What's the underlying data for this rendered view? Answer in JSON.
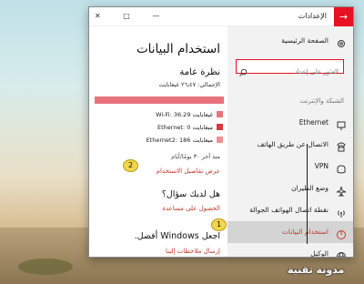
{
  "window": {
    "title": "الإعدادات",
    "back_icon": "back-arrow-icon"
  },
  "sidebar": {
    "home_label": "الصفحة الرئيسية",
    "search_placeholder": "العثور على إعداد",
    "section_header": "الشبكة والإنترنت",
    "items": [
      {
        "label": "Ethernet",
        "icon": "ethernet-icon"
      },
      {
        "label": "الاتصال عن طريق الهاتف",
        "icon": "dialup-icon"
      },
      {
        "label": "VPN",
        "icon": "vpn-icon"
      },
      {
        "label": "وضع الطيران",
        "icon": "airplane-icon"
      },
      {
        "label": "نقطة اتصال الهواتف الجوالة",
        "icon": "hotspot-icon"
      },
      {
        "label": "استخدام البيانات",
        "icon": "data-usage-icon",
        "active": true
      },
      {
        "label": "الوكيل",
        "icon": "globe-icon"
      }
    ]
  },
  "main": {
    "title": "استخدام البيانات",
    "overview_heading": "نظرة عامة",
    "total": "الإجمالي: ٢٦٫٤٧ غيغابايت",
    "usage_fill_fraction": 1.0,
    "networks": [
      {
        "label": "Wi-Fi: 36.29 غيغابايت",
        "color": "#e8737d"
      },
      {
        "label": "Ethernet: 0 ميغابايت",
        "color": "#d9363e"
      },
      {
        "label": "Ethernet2: 186 ميغابايت",
        "color": "#ee8f95"
      }
    ],
    "period": "منذ آخر ٣٠ يومًا/أيام",
    "details_link": "عرض تفاصيل الاستخدام",
    "question_heading": "هل لديك سؤال؟",
    "help_link": "الحصول على مساعدة",
    "improve_heading": "اجعل Windows أفضل.",
    "feedback_link": "إرسال ملاحظات إلينا"
  },
  "callouts": [
    "1",
    "2"
  ],
  "watermark": "مدونة تقنية"
}
